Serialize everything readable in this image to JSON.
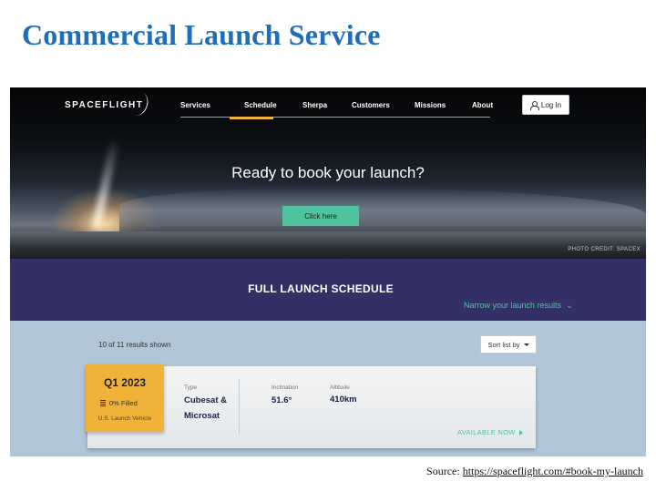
{
  "slide": {
    "title": "Commercial Launch Service",
    "source_label": "Source: ",
    "source_url": "https://spaceflight.com/#book-my-launch"
  },
  "site": {
    "logo_text": "SPACEFLIGHT",
    "nav": [
      "Services",
      "Schedule",
      "Sherpa",
      "Customers",
      "Missions",
      "About"
    ],
    "nav_active": "Schedule",
    "login_label": "Log In"
  },
  "hero": {
    "headline": "Ready to book your launch?",
    "cta_label": "Click here",
    "photo_credit": "PHOTO CREDIT: SPACEX"
  },
  "schedule": {
    "title": "FULL LAUNCH SCHEDULE",
    "narrow_label": "Narrow your launch results",
    "results_text": "10 of 11 results shown",
    "sort_label": "Sort list by"
  },
  "card": {
    "quarter": "Q1 2023",
    "filled": "0% Filled",
    "vehicle": "U.S. Launch Vehicle",
    "type_label": "Type",
    "type_value_1": "Cubesat &",
    "type_value_2": "Microsat",
    "inclination_label": "Inclination",
    "inclination_value": "51.6°",
    "altitude_label": "Altitude",
    "altitude_value": "410km",
    "status": "AVAILABLE NOW"
  },
  "colors": {
    "title_blue": "#1f6fb8",
    "accent_green": "#4fc39e",
    "accent_gold": "#f0b239",
    "band_purple": "#333066"
  }
}
